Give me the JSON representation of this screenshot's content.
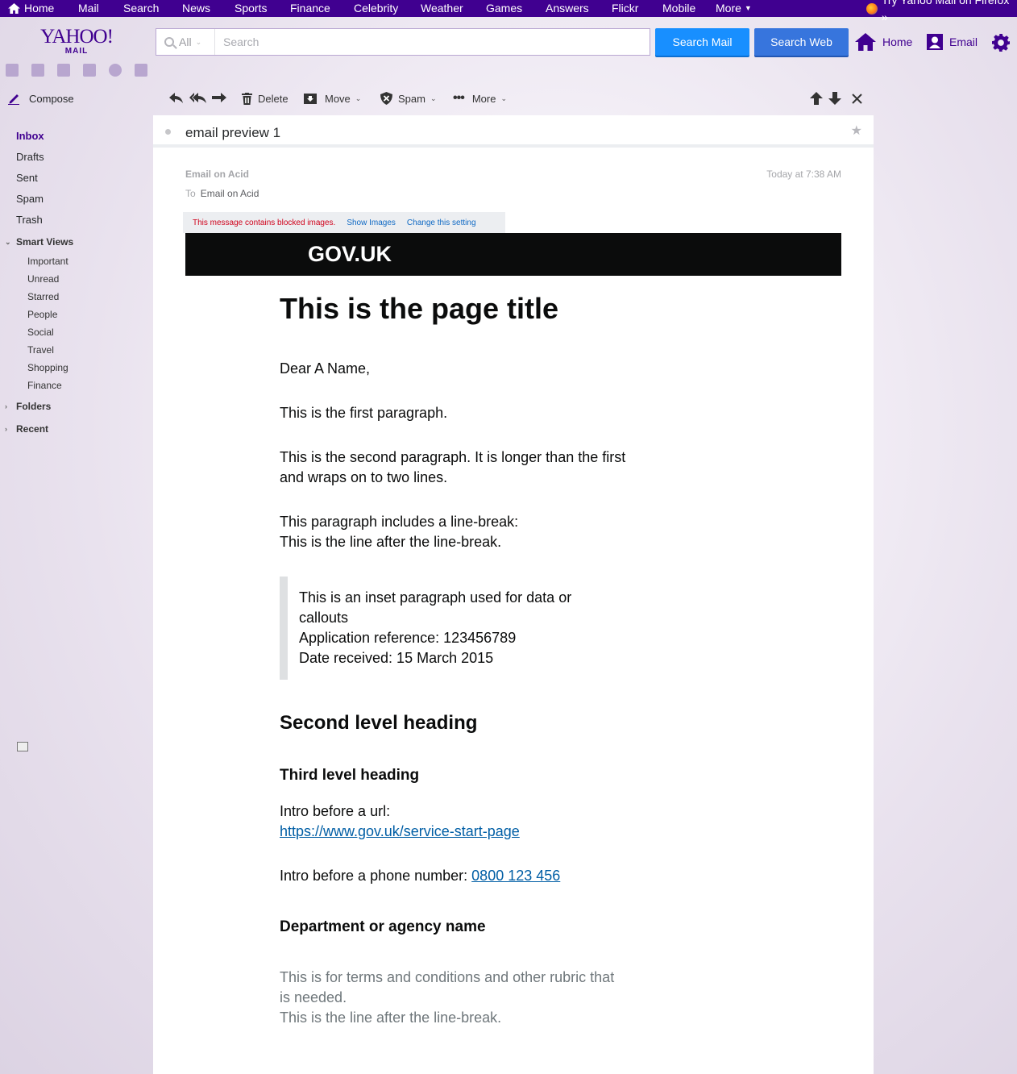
{
  "topnav": {
    "items": [
      "Home",
      "Mail",
      "Search",
      "News",
      "Sports",
      "Finance",
      "Celebrity",
      "Weather",
      "Games",
      "Answers",
      "Flickr",
      "Mobile",
      "More"
    ],
    "promo": "Try Yahoo Mail on Firefox »"
  },
  "header": {
    "logo_line1": "YAHOO!",
    "logo_line2": "MAIL",
    "search_scope": "All",
    "search_placeholder": "Search",
    "search_mail_label": "Search Mail",
    "search_web_label": "Search Web",
    "home_label": "Home",
    "email_label": "Email"
  },
  "sidebar": {
    "compose_label": "Compose",
    "folders": [
      "Inbox",
      "Drafts",
      "Sent",
      "Spam",
      "Trash"
    ],
    "smart_views_label": "Smart Views",
    "smart_views": [
      "Important",
      "Unread",
      "Starred",
      "People",
      "Social",
      "Travel",
      "Shopping",
      "Finance"
    ],
    "folders_group_label": "Folders",
    "recent_label": "Recent"
  },
  "toolbar": {
    "delete_label": "Delete",
    "move_label": "Move",
    "spam_label": "Spam",
    "more_label": "More"
  },
  "message": {
    "subject": "email preview 1",
    "sender": "Email on Acid",
    "to_label": "To",
    "recipient": "Email on Acid",
    "timestamp": "Today at 7:38 AM",
    "blocked_notice": "This message contains blocked images.",
    "show_images": "Show Images",
    "change_setting": "Change this setting"
  },
  "email_body": {
    "banner": "GOV.UK",
    "title": "This is the page title",
    "greeting": "Dear A Name,",
    "para1": "This is the first paragraph.",
    "para2": "This is the second paragraph. It is longer than the first and wraps on to two lines.",
    "para3_line1": "This paragraph includes a line-break:",
    "para3_line2": "This is the line after the line-break.",
    "inset_line1": "This is an inset paragraph used for data or callouts",
    "inset_line2": "Application reference: 123456789",
    "inset_line3": "Date received: 15 March 2015",
    "h2": "Second level heading",
    "h3": "Third level heading",
    "url_intro": "Intro before a url:",
    "url": "https://www.gov.uk/service-start-page",
    "phone_intro": "Intro before a phone number:",
    "phone": "0800 123 456",
    "department": "Department or agency name",
    "rubric_line1": "This is for terms and conditions and other rubric that is needed.",
    "rubric_line2": "This is the line after the line-break."
  },
  "colors": {
    "brand_purple": "#400090",
    "search_mail_blue": "#188fff",
    "search_web_blue": "#3775dd",
    "link_blue": "#005ea5",
    "blocked_red": "#d0021b"
  }
}
